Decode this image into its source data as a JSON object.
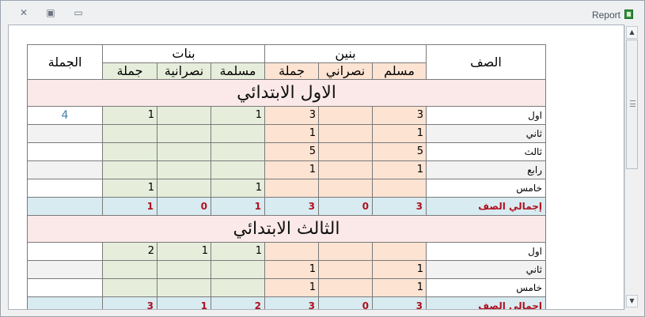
{
  "window": {
    "title": "Report"
  },
  "headers": {
    "class": "الصف",
    "boys": "بنين",
    "girls": "بنات",
    "total": "الجملة",
    "boys_muslim": "مسلم",
    "boys_christian": "نصراني",
    "boys_total": "جملة",
    "girls_muslim": "مسلمة",
    "girls_christian": "نصرانية",
    "girls_total": "جملة"
  },
  "sections": [
    {
      "title": "الاول الابتدائي",
      "rows": [
        {
          "label": "اول",
          "bm": "3",
          "bc": "",
          "bt": "3",
          "gm": "1",
          "gc": "",
          "gt": "1",
          "total": "4"
        },
        {
          "label": "ثاني",
          "bm": "1",
          "bc": "",
          "bt": "1",
          "gm": "",
          "gc": "",
          "gt": "",
          "total": ""
        },
        {
          "label": "ثالث",
          "bm": "5",
          "bc": "",
          "bt": "5",
          "gm": "",
          "gc": "",
          "gt": "",
          "total": ""
        },
        {
          "label": "رابع",
          "bm": "1",
          "bc": "",
          "bt": "1",
          "gm": "",
          "gc": "",
          "gt": "",
          "total": ""
        },
        {
          "label": "خامس",
          "bm": "",
          "bc": "",
          "bt": "",
          "gm": "1",
          "gc": "",
          "gt": "1",
          "total": ""
        }
      ],
      "totals": {
        "label": "إجمالي الصف",
        "bm": "3",
        "bc": "0",
        "bt": "3",
        "gm": "1",
        "gc": "0",
        "gt": "1"
      }
    },
    {
      "title": "الثالث الابتدائي",
      "rows": [
        {
          "label": "اول",
          "bm": "",
          "bc": "",
          "bt": "",
          "gm": "1",
          "gc": "1",
          "gt": "2",
          "total": ""
        },
        {
          "label": "ثاني",
          "bm": "1",
          "bc": "",
          "bt": "1",
          "gm": "",
          "gc": "",
          "gt": "",
          "total": ""
        },
        {
          "label": "خامس",
          "bm": "1",
          "bc": "",
          "bt": "1",
          "gm": "",
          "gc": "",
          "gt": "",
          "total": ""
        }
      ],
      "totals": {
        "label": "إجمالي الصف",
        "bm": "3",
        "bc": "0",
        "bt": "3",
        "gm": "2",
        "gc": "1",
        "gt": "3"
      }
    }
  ]
}
